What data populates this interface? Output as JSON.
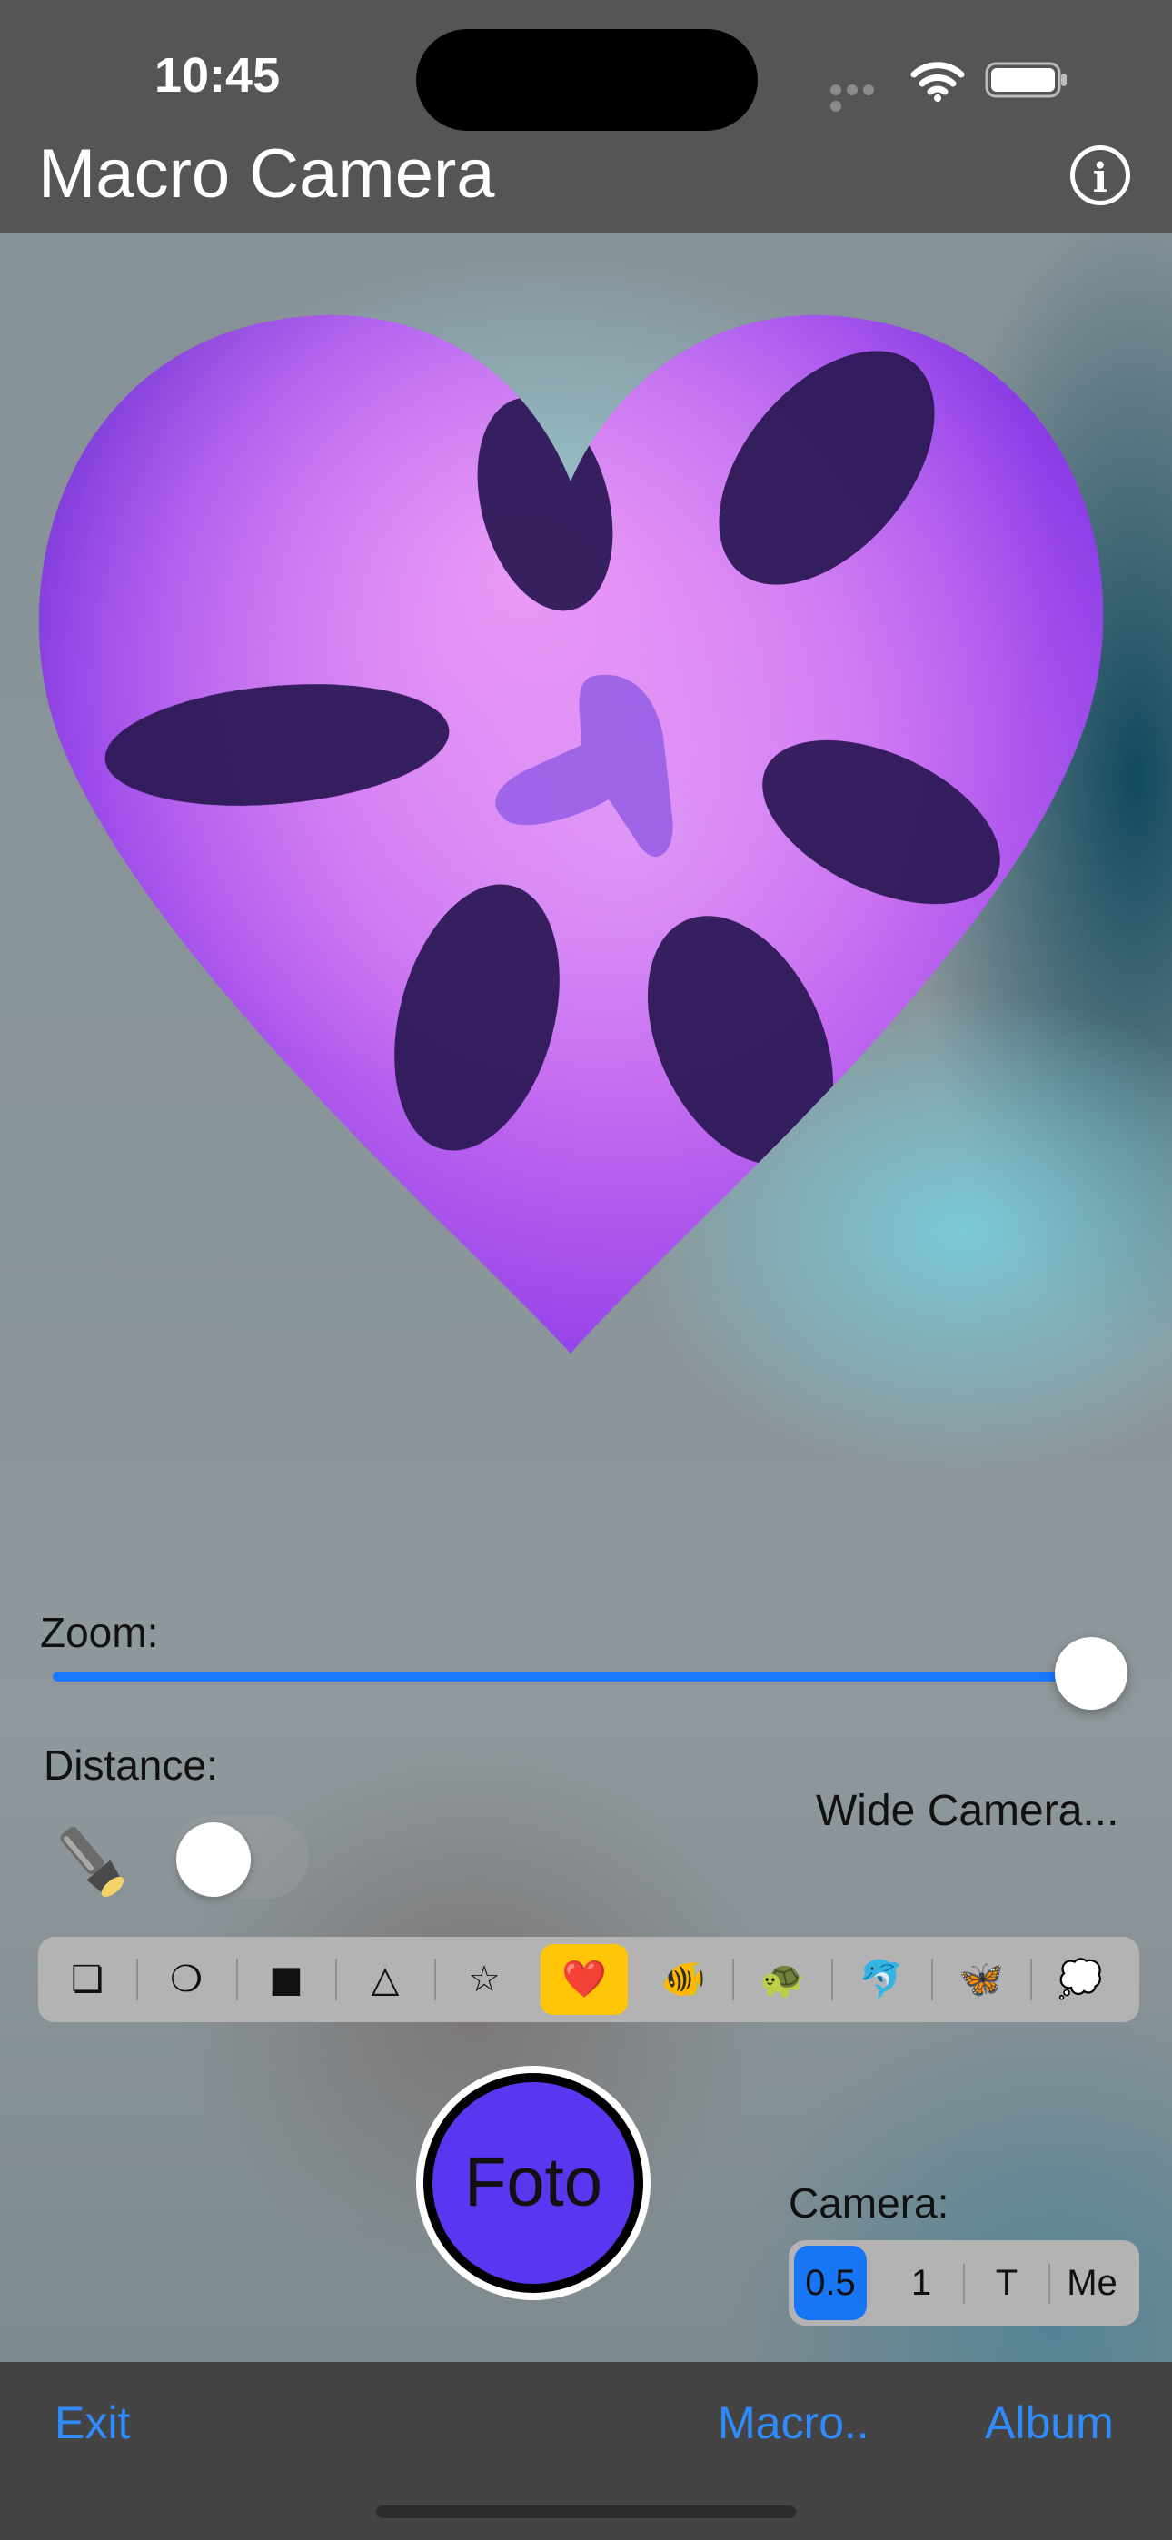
{
  "status_bar": {
    "time": "10:45"
  },
  "nav": {
    "title": "Macro Camera",
    "info_icon": "info-circle-icon"
  },
  "zoom": {
    "label": "Zoom:",
    "value_fraction": 1.0
  },
  "distance": {
    "label": "Distance:",
    "camera_status": "Wide Camera...",
    "torch_icon": "flashlight-icon",
    "torch_on": false
  },
  "shapes": {
    "items": [
      {
        "glyph": "❏",
        "icon": "square-shadow-icon"
      },
      {
        "glyph": "❍",
        "icon": "circle-icon"
      },
      {
        "glyph": "■",
        "icon": "filled-square-icon"
      },
      {
        "glyph": "△",
        "icon": "triangle-icon"
      },
      {
        "glyph": "☆",
        "icon": "star-icon"
      },
      {
        "glyph": "❤️",
        "icon": "heart-icon"
      },
      {
        "glyph": "🐠",
        "icon": "fish-icon"
      },
      {
        "glyph": "🐢",
        "icon": "turtle-icon"
      },
      {
        "glyph": "🐬",
        "icon": "dolphin-icon"
      },
      {
        "glyph": "🦋",
        "icon": "butterfly-icon"
      },
      {
        "glyph": "💭",
        "icon": "thought-bubble-icon"
      }
    ],
    "selected_index": 5
  },
  "shutter": {
    "label": "Foto"
  },
  "camera": {
    "label": "Camera:",
    "options": [
      "0.5",
      "1",
      "T",
      "Me"
    ],
    "selected_index": 0
  },
  "toolbar": {
    "exit": "Exit",
    "macro": "Macro..",
    "album": "Album"
  },
  "colors": {
    "accent": "#2f8cff",
    "shutter": "#5b36f1",
    "selected_shape": "#ffc506",
    "selected_camera": "#1676f3"
  }
}
